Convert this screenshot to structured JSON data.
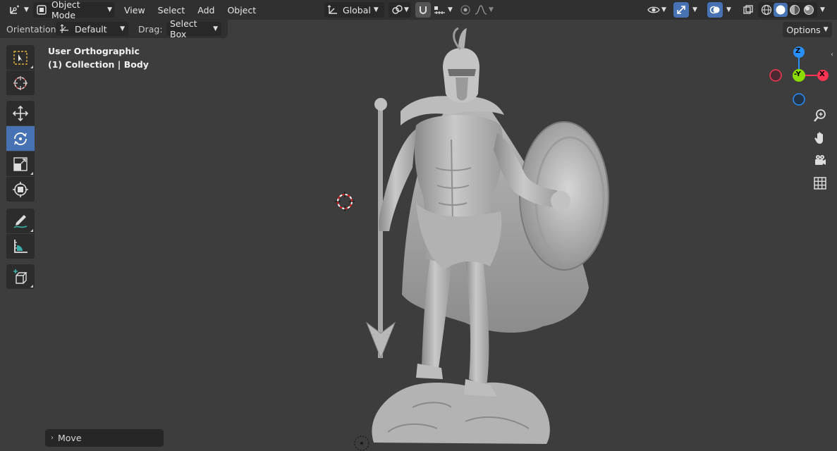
{
  "header": {
    "mode_label": "Object Mode",
    "menu": [
      "View",
      "Select",
      "Add",
      "Object"
    ],
    "transform_orientation": "Global",
    "icons": [
      "editor-type-icon",
      "object-mode-icon",
      "transform-orientation-icon",
      "pivot-icon",
      "snap-icon",
      "snap-increment-icon",
      "proportional-edit-icon",
      "falloff-icon",
      "visibility-icon",
      "gizmo-icon",
      "overlays-icon",
      "xray-icon",
      "wireframe-shading-icon",
      "solid-shading-icon",
      "material-shading-icon",
      "rendered-shading-icon"
    ]
  },
  "tool_settings": {
    "orientation_label": "Orientation:",
    "orientation_value": "Default",
    "drag_label": "Drag:",
    "drag_value": "Select Box",
    "options_label": "Options"
  },
  "toolbar": {
    "tools": [
      "select-box",
      "cursor",
      "move",
      "rotate",
      "scale",
      "transform",
      "annotate",
      "measure",
      "add-cube"
    ],
    "active_tool": "rotate"
  },
  "viewport": {
    "view_name": "User Orthographic",
    "collection_info": "(1) Collection | Body",
    "object": "spartan warrior sculpt"
  },
  "navigation_gizmo": {
    "axes": {
      "x": "X",
      "y": "-Y",
      "z": "Z"
    },
    "colors": {
      "x": "#ff3352",
      "y": "#8bdc00",
      "z": "#2890ff"
    },
    "buttons": [
      "zoom-icon",
      "pan-hand-icon",
      "camera-icon",
      "grid-icon"
    ]
  },
  "last_operator": {
    "label": "Move"
  },
  "colors": {
    "viewport_bg": "#3d3d3d",
    "header_bg": "#303030",
    "accent": "#4772b3"
  }
}
